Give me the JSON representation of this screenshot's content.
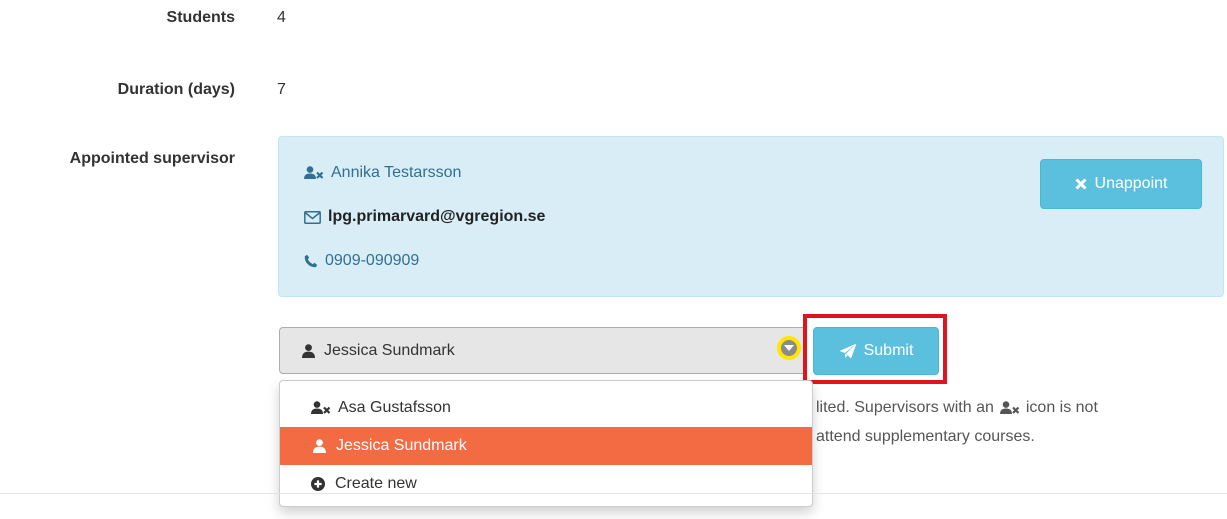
{
  "details": {
    "students_label": "Students",
    "students_value": "4",
    "duration_label": "Duration (days)",
    "duration_value": "7",
    "supervisor_label": "Appointed supervisor"
  },
  "supervisor": {
    "name": "Annika Testarsson",
    "email": "lpg.primarvard@vgregion.se",
    "phone": "0909-090909",
    "unappoint_label": "Unappoint"
  },
  "select": {
    "selected": "Jessica Sundmark",
    "submit_label": "Submit"
  },
  "dropdown": {
    "options": [
      {
        "label": "Asa Gustafsson",
        "icon": "user-times-icon"
      },
      {
        "label": "Jessica Sundmark",
        "icon": "user-icon",
        "active": true
      },
      {
        "label": "Create new",
        "icon": "plus-circle-icon"
      }
    ]
  },
  "help": {
    "line1a": "lited. Supervisors with an",
    "line1b": "icon is not",
    "line2": "attend supplementary courses."
  },
  "colors": {
    "info_bg": "#d9edf7",
    "info_button": "#5bc0de",
    "active_option": "#f26b43",
    "highlight_box": "#e0141c",
    "caret_highlight": "#ffe600"
  }
}
